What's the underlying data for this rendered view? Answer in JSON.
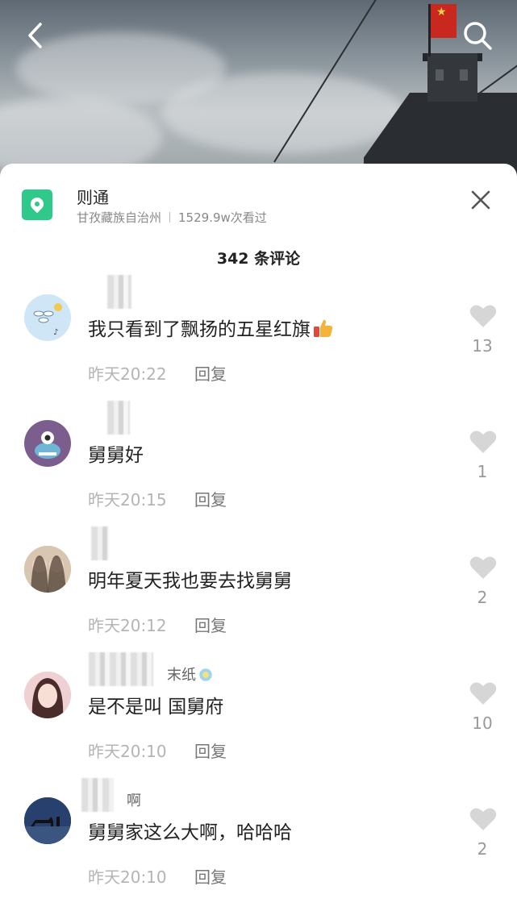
{
  "nav": {
    "back_icon": "chevron-left-icon",
    "search_icon": "search-icon"
  },
  "location": {
    "name": "则通",
    "region": "甘孜藏族自治州",
    "views": "1529.9w次看过",
    "icon": "location-pin-icon",
    "accent": "#2fc98b"
  },
  "close_icon": "close-icon",
  "comments_header": "342 条评论",
  "comments": [
    {
      "username_visible": "",
      "text": "我只看到了飘扬的五星红旗",
      "emoji": "thumbs-up-icon",
      "time": "昨天20:22",
      "reply": "回复",
      "likes": "13"
    },
    {
      "username_visible": "",
      "text": "舅舅好",
      "time": "昨天20:15",
      "reply": "回复",
      "likes": "1"
    },
    {
      "username_visible": "",
      "text": "明年夏天我也要去找舅舅",
      "time": "昨天20:12",
      "reply": "回复",
      "likes": "2"
    },
    {
      "username_visible": "末纸",
      "text": "是不是叫 国舅府",
      "time": "昨天20:10",
      "reply": "回复",
      "likes": "10"
    },
    {
      "username_visible": "啊",
      "text": "舅舅家这么大啊，哈哈哈",
      "time": "昨天20:10",
      "reply": "回复",
      "likes": "2"
    }
  ],
  "colors": {
    "text_primary": "#222222",
    "text_muted": "#b4b4b4",
    "like_icon": "#d6d6d6"
  }
}
